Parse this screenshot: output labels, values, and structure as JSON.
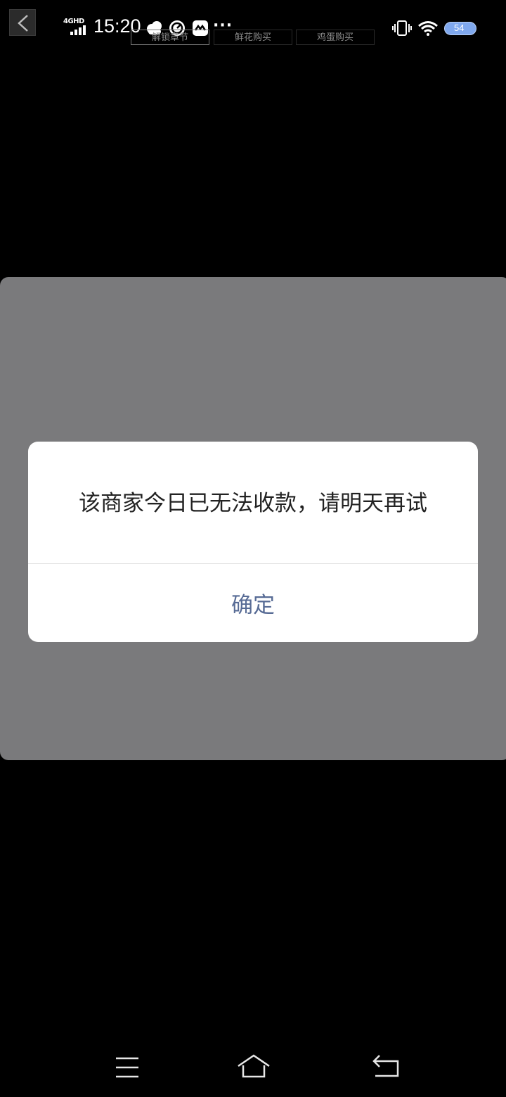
{
  "status_bar": {
    "network": "4GHD",
    "time": "15:20",
    "battery": "54",
    "icons": [
      "signal-icon",
      "cloud-icon",
      "timer-app-icon",
      "message-app-icon",
      "more-icon",
      "vibrate-icon",
      "wifi-icon",
      "battery-icon"
    ]
  },
  "web_tabs": [
    {
      "label": "解锁章节",
      "active": true
    },
    {
      "label": "鲜花购买",
      "active": false
    },
    {
      "label": "鸡蛋购买",
      "active": false
    }
  ],
  "dialog": {
    "message": "该商家今日已无法收款，请明天再试",
    "confirm_label": "确定"
  },
  "colors": {
    "background": "#000000",
    "overlay_panel": "#7a7a7c",
    "dialog_background": "#ffffff",
    "confirm_text": "#576b95",
    "message_text": "#222222",
    "battery": "#7fa8ee"
  },
  "nav_bar": {
    "icons": [
      "menu-icon",
      "home-icon",
      "back-icon"
    ]
  }
}
